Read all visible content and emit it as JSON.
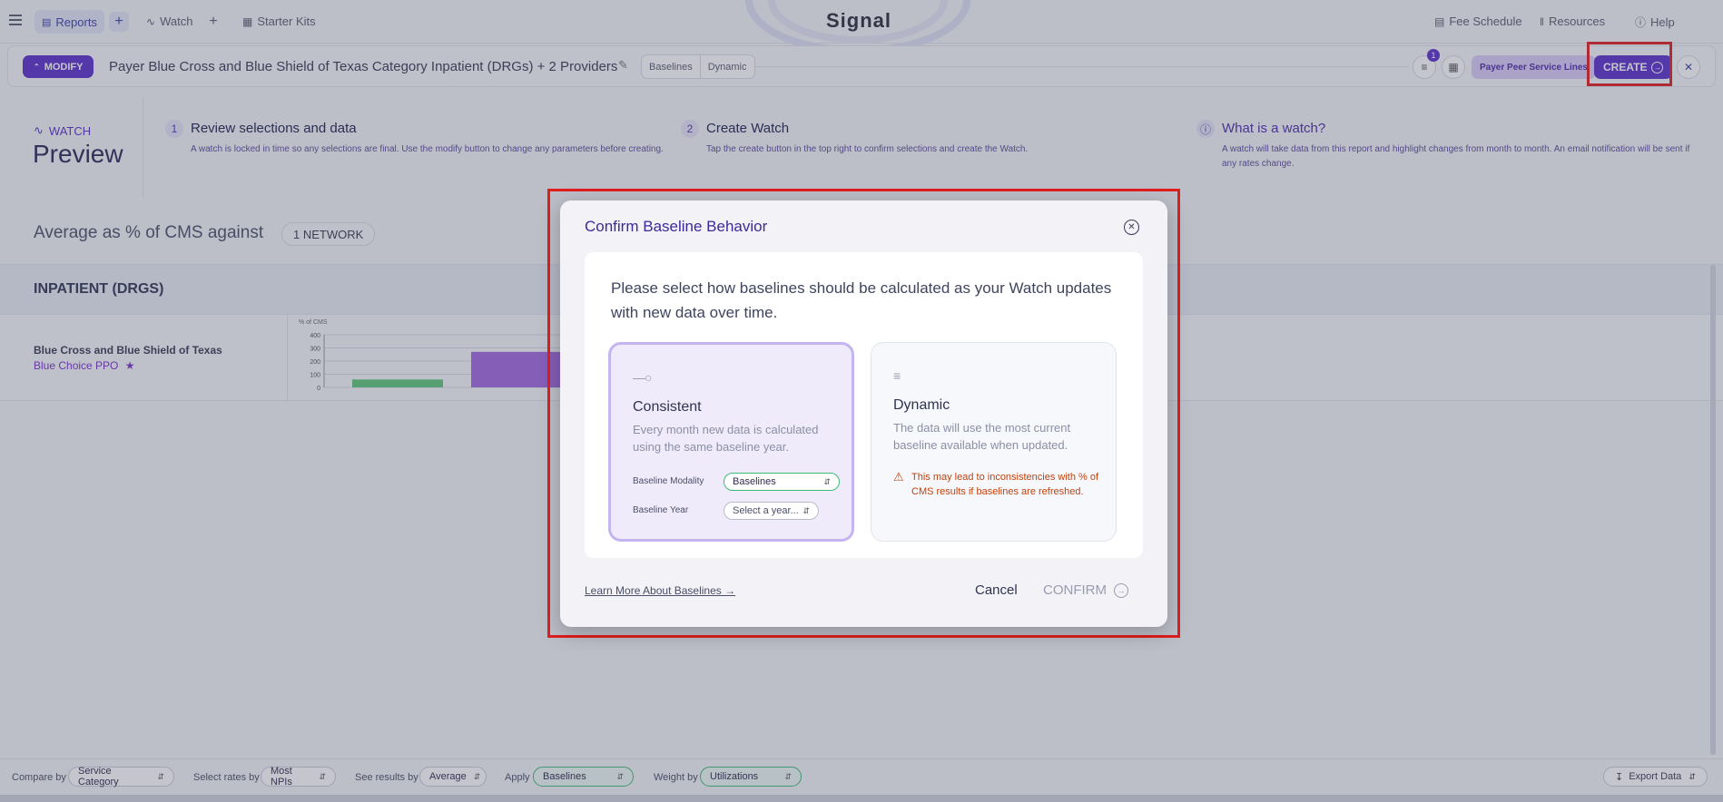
{
  "nav": {
    "tab_reports": "Reports",
    "tab_watch": "Watch",
    "starter_kits": "Starter Kits",
    "brand": "Signal",
    "fee_schedule": "Fee Schedule",
    "resources": "Resources",
    "help": "Help"
  },
  "report_bar": {
    "modify_label": "MODIFY",
    "title": "Payer Blue Cross and Blue Shield of Texas Category Inpatient (DRGs) + 2 Providers",
    "chips": [
      "Baselines",
      "Dynamic"
    ],
    "filter_count": "1",
    "peer_chip": "Payer Peer Service Lines",
    "create_label": "CREATE"
  },
  "preview": {
    "watch_label": "WATCH",
    "title": "Preview",
    "steps": [
      {
        "num": "1",
        "title": "Review selections and data",
        "text": "A watch is locked in time so any selections are final. Use the modify button to change any parameters before creating."
      },
      {
        "num": "2",
        "title": "Create Watch",
        "text": "Tap the create button in the top right to confirm selections and create the Watch."
      }
    ],
    "info": {
      "title": "What is a watch?",
      "text": "A watch will take data from this report and highlight changes from month to month. An email notification will be sent if any rates change."
    }
  },
  "section": {
    "avg_title": "Average as % of CMS against",
    "network_chip": "1 NETWORK",
    "category_title": "INPATIENT (DRGS)",
    "payer_name": "Blue Cross and Blue Shield of Texas",
    "payer_plan": "Blue Choice PPO"
  },
  "chart_data": {
    "type": "bar",
    "ylabel": "% of CMS",
    "y_ticks": [
      "400",
      "300",
      "200",
      "100",
      "0"
    ],
    "ylim": [
      0,
      400
    ],
    "series": [
      {
        "values": [
          60
        ],
        "color": "#5ec87a"
      },
      {
        "values": [
          270
        ],
        "color": "#a367e0"
      }
    ]
  },
  "modal": {
    "title": "Confirm Baseline Behavior",
    "question": "Please select how baselines should be calculated as your Watch updates with new data over time.",
    "consistent": {
      "title": "Consistent",
      "desc": "Every month new data is calculated using the same baseline year.",
      "modality_label": "Baseline Modality",
      "modality_value": "Baselines",
      "year_label": "Baseline Year",
      "year_placeholder": "Select a year..."
    },
    "dynamic": {
      "title": "Dynamic",
      "desc": "The data will use the most current baseline available when updated.",
      "warning": "This may lead to inconsistencies with % of CMS results if baselines are refreshed."
    },
    "learn_more": "Learn More About Baselines →",
    "cancel": "Cancel",
    "confirm": "CONFIRM"
  },
  "bottom": {
    "compare_label": "Compare by",
    "compare_value": "Service Category",
    "rates_label": "Select rates by",
    "rates_value": "Most NPIs",
    "results_label": "See results by",
    "results_value": "Average",
    "apply_label": "Apply",
    "apply_value": "Baselines",
    "weight_label": "Weight by",
    "weight_value": "Utilizations",
    "export": "Export Data"
  }
}
